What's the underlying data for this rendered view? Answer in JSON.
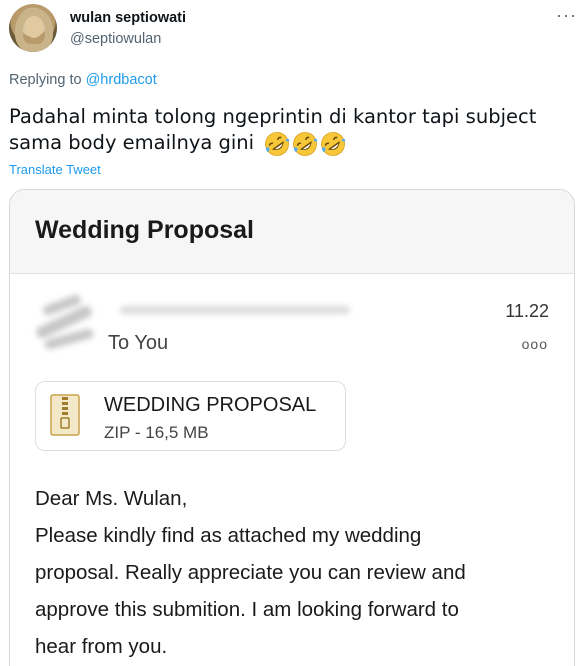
{
  "author": {
    "name": "wulan septiowati",
    "handle": "@septiowulan"
  },
  "reply": {
    "prefix": "Replying to ",
    "to": "@hrdbacot"
  },
  "tweet": {
    "text": "Padahal minta tolong ngeprintin di kantor tapi subject sama body emailnya gini",
    "emoji": [
      "rolling-on-floor-laughing",
      "rolling-on-floor-laughing",
      "rolling-on-floor-laughing"
    ],
    "translate_label": "Translate Tweet",
    "more_label": "···"
  },
  "email": {
    "subject": "Wedding Proposal",
    "to_label": "To You",
    "time": "11.22",
    "more_label": "ooo",
    "attachment": {
      "name": "WEDDING PROPOSAL",
      "size": "ZIP - 16,5 MB",
      "icon": "zip-file-icon"
    },
    "body": [
      "Dear Ms. Wulan,",
      "Please kindly find as attached my wedding",
      "proposal. Really appreciate you can review and",
      "approve this submition. I am looking forward to",
      "hear from you."
    ]
  },
  "colors": {
    "link": "#1d9bf0",
    "muted": "#536471",
    "text": "#0f1419",
    "border": "#cfd9de"
  }
}
